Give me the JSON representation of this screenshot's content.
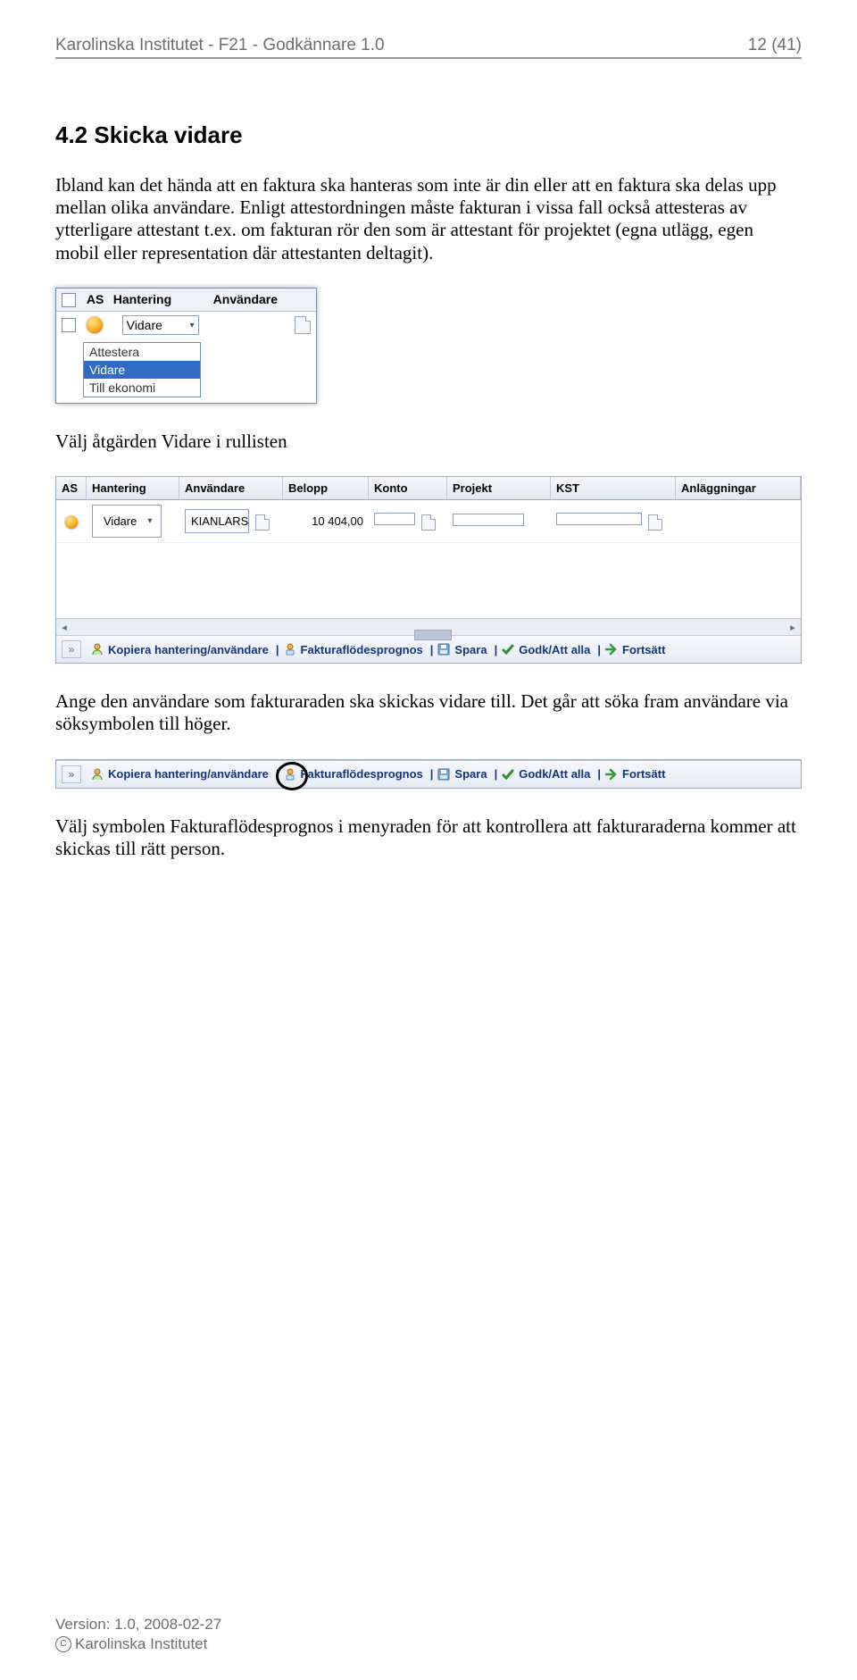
{
  "header": {
    "left": "Karolinska Institutet - F21 - Godkännare 1.0",
    "right": "12 (41)"
  },
  "heading": "4.2 Skicka vidare",
  "para1": "Ibland kan det hända att en faktura ska hanteras som inte är din eller att en faktura ska delas upp mellan olika användare. Enligt attestordningen måste fakturan i vissa fall också attesteras av ytterligare attestant t.ex. om fakturan rör den som är attestant för projektet (egna utlägg, egen mobil eller representation där attestanten deltagit).",
  "widget": {
    "cols": {
      "as": "AS",
      "hantering": "Hantering",
      "anvandare": "Användare"
    },
    "selected": "Vidare",
    "options": [
      "Attestera",
      "Vidare",
      "Till ekonomi"
    ]
  },
  "para2": "Välj åtgärden Vidare i rullisten",
  "grid": {
    "cols": {
      "as": "AS",
      "hantering": "Hantering",
      "anvandare": "Användare",
      "belopp": "Belopp",
      "konto": "Konto",
      "projekt": "Projekt",
      "kst": "KST",
      "anlaggningar": "Anläggningar"
    },
    "row": {
      "hantering": "Vidare",
      "anvandare": "KIANLARS",
      "belopp": "10 404,00"
    }
  },
  "toolbar": {
    "kopiera": "Kopiera hantering/användare",
    "prognos": "Fakturaflödesprognos",
    "spara": "Spara",
    "godk": "Godk/Att alla",
    "fortsatt": "Fortsätt"
  },
  "para3": "Ange den användare som fakturaraden ska skickas vidare till. Det går att söka fram användare via söksymbolen till höger.",
  "para4": "Välj symbolen Fakturaflödesprognos i menyraden för att kontrollera att fakturaraderna kommer att skickas till rätt person.",
  "footer": {
    "version": "Version: 1.0, 2008-02-27",
    "org": "Karolinska Institutet"
  }
}
